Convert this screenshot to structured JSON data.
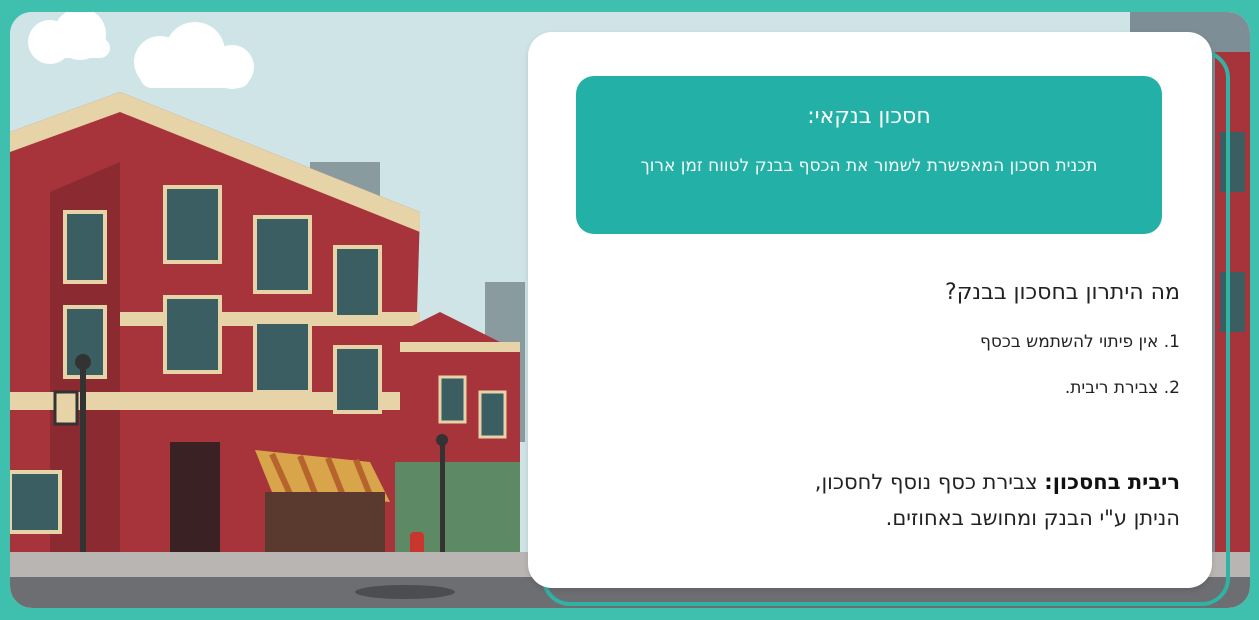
{
  "banner": {
    "title": "חסכון בנקאי:",
    "text": "תכנית חסכון המאפשרת לשמור את הכסף בבנק לטווח זמן ארוך"
  },
  "question": {
    "title": "מה היתרון בחסכון בבנק?",
    "items": [
      {
        "label": "1. אין פיתוי להשתמש בכסף"
      },
      {
        "label": "2. צבירת ריבית."
      }
    ]
  },
  "definition": {
    "term": "ריבית בחסכון:",
    "line1": "צבירת כסף נוסף לחסכון,",
    "line2": "הניתן ע\"י הבנק ומחושב באחוזים."
  },
  "colors": {
    "accent": "#23b0a6",
    "frame": "#3fbfae",
    "brick": "#a8343b"
  }
}
